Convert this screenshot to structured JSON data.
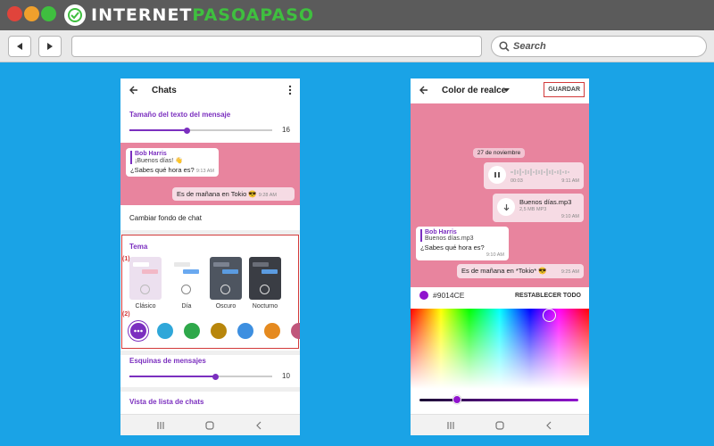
{
  "browser": {
    "brand_left": "INTERNET",
    "brand_right": "PASOAPASO",
    "search_label": "Search"
  },
  "left_phone": {
    "title": "Chats",
    "text_size_title": "Tamaño del texto del mensaje",
    "text_size_value": "16",
    "text_size_level": 0.4,
    "chat": {
      "incoming_name": "Bob Harris",
      "incoming_quote": "¡Buenos días! 👋",
      "incoming_text": "¿Sabes qué hora es?",
      "incoming_time": "9:13 AM",
      "outgoing_text": "Es de mañana en Tokio 😎",
      "outgoing_time": "9:28 AM"
    },
    "change_bg": "Cambiar fondo de chat",
    "theme_title": "Tema",
    "marker_1": "(1)",
    "marker_2": "(2)",
    "themes": [
      {
        "label": "Clásico"
      },
      {
        "label": "Día"
      },
      {
        "label": "Oscuro"
      },
      {
        "label": "Nocturno"
      }
    ],
    "accent_colors": [
      "#7b2fbf",
      "#2fa7d9",
      "#2ea84a",
      "#b8860b",
      "#3d8fe0",
      "#e58a1f",
      "#c0567b"
    ],
    "corners_title": "Esquinas de mensajes",
    "corners_value": "10",
    "corners_level": 0.6,
    "list_title": "Vista de lista de chats"
  },
  "right_phone": {
    "title": "Color de realce",
    "save_label": "GUARDAR",
    "chat": {
      "date": "27 de noviembre",
      "voice_time": "00:03",
      "voice_msg_time": "9:11 AM",
      "file_name": "Buenos días.mp3",
      "file_size": "2,5 MB MP3",
      "file_time": "9:10 AM",
      "reply_name": "Bob Harris",
      "reply_quote": "Buenos días.mp3",
      "reply_text": "¿Sabes qué hora es?",
      "reply_time": "9:10 AM",
      "outgoing_text": "Es de mañana en *Tokio* 😎",
      "outgoing_time": "9:25 AM"
    },
    "hex_value": "#9014CE",
    "reset_label": "RESTABLECER TODO",
    "accent_color": "#9014ce"
  }
}
